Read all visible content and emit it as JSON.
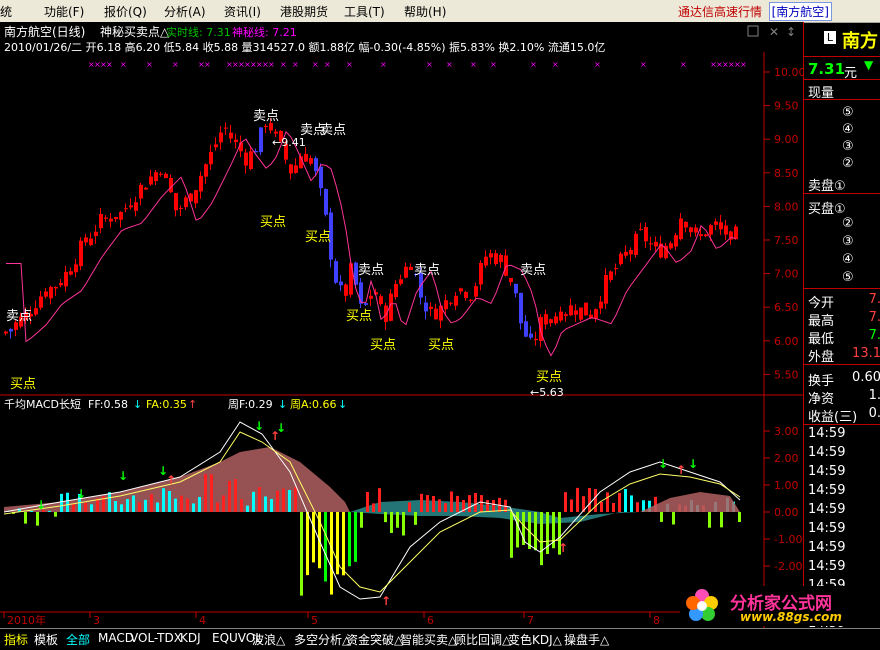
{
  "menu": {
    "items": [
      "统",
      "功能(F)",
      "报价(Q)",
      "分析(A)",
      "资讯(I)",
      "港股期货",
      "工具(T)",
      "帮助(H)"
    ],
    "title": "通达信高速行情",
    "stock": "[南方航空]"
  },
  "header": {
    "line1_name": "南方航空(日线)",
    "line1_indicator": "神秘买卖点△",
    "line1_realtime": "实时线: 7.31",
    "line1_shenmi": "神秘线: 7.21",
    "line2": "2010/01/26/二 开6.18 高6.20 低5.84 收5.88 量314527.0 额1.88亿 幅-0.30(-4.85%) 振5.83% 换2.10% 流通15.0亿"
  },
  "main_labels": {
    "sell": "卖点",
    "buy": "买点",
    "high_value": "9.41",
    "low_value": "5.63"
  },
  "main_axis": [
    "10.00",
    "9.50",
    "9.00",
    "8.50",
    "8.00",
    "7.50",
    "7.00",
    "6.50",
    "6.00",
    "5.50"
  ],
  "sub": {
    "title": "千均MACD长短",
    "ff": "FF:0.58",
    "fa": "FA:0.35",
    "zf": "周F:0.29",
    "za": "周A:0.66"
  },
  "sub_axis": [
    "3.00",
    "2.00",
    "1.00",
    "0.00",
    "-1.00",
    "-2.00"
  ],
  "x_axis": [
    "2010年",
    "3",
    "4",
    "5",
    "6",
    "7",
    "8"
  ],
  "right_panel": {
    "name": "南方",
    "price": "7.31",
    "price_unit": "元",
    "now_volume": "现量",
    "sell_levels": [
      "⑤",
      "④",
      "③",
      "②",
      "卖盘①"
    ],
    "buy_levels": [
      "买盘①",
      "②",
      "③",
      "④",
      "⑤"
    ],
    "stats": [
      {
        "label": "今开",
        "value": "7."
      },
      {
        "label": "最高",
        "value": "7."
      },
      {
        "label": "最低",
        "value": "7."
      },
      {
        "label": "外盘",
        "value": "13.1"
      },
      {
        "label": "换手",
        "value": "0.60"
      },
      {
        "label": "净资",
        "value": "1."
      },
      {
        "label": "收益(三)",
        "value": "0."
      }
    ],
    "times": [
      "14:59",
      "14:59",
      "14:59",
      "14:59",
      "14:59",
      "14:59",
      "14:59",
      "14:59",
      "14:59",
      "14:59",
      "14:59",
      "15:00"
    ]
  },
  "tabs": [
    "指标",
    "模板",
    "全部",
    "MACD",
    "VOL-TDX",
    "KDJ",
    "EQUVOL",
    "波浪△",
    "多空分析△",
    "资金突破△",
    "智能买卖△",
    "顾比回调△",
    "变色KDJ△",
    "操盘手△"
  ],
  "watermark": {
    "name": "分析家公式网",
    "url": "www.88gs.com"
  },
  "colors": {
    "up": "#ff0000",
    "down": "#4040ff",
    "bg": "#000000",
    "axis": "#c00000",
    "cyan": "#00ffff",
    "yellow": "#ffff00"
  }
}
